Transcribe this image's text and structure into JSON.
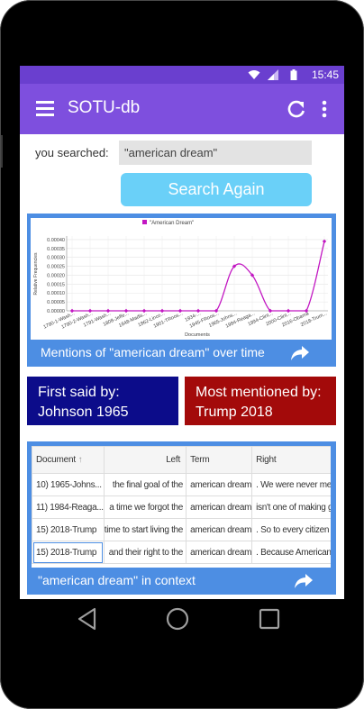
{
  "status_bar": {
    "time": "15:45"
  },
  "app_bar": {
    "title": "SOTU-db"
  },
  "search": {
    "label": "you searched:",
    "value": "\"american dream\"",
    "button_label": "Search Again"
  },
  "chart_card": {
    "caption": "Mentions of \"american dream\" over time"
  },
  "first_said": {
    "line1": "First said by:",
    "line2": "Johnson 1965"
  },
  "most_mentioned": {
    "line1": "Most mentioned by:",
    "line2": "Trump 2018"
  },
  "context_table": {
    "headers": {
      "document": "Document",
      "left": "Left",
      "term": "Term",
      "right": "Right"
    },
    "rows": [
      {
        "document": "10) 1965-Johns...",
        "left": "the final goal of the",
        "term": "american dream",
        "right": ". We were never meant to"
      },
      {
        "document": "11) 1984-Reaga...",
        "left": "a time we forgot the",
        "term": "american dream",
        "right": "isn't one of making government"
      },
      {
        "document": "15) 2018-Trump",
        "left": "time to start living the",
        "term": "american dream",
        "right": ". So to every citizen watching"
      },
      {
        "document": "15) 2018-Trump",
        "left": "and their right to the",
        "term": "american dream",
        "right": ". Because Americans are dreamers too"
      }
    ],
    "caption": "\"american dream\" in context"
  },
  "colors": {
    "status_bar": "#6a3fcf",
    "app_bar": "#7e4fde",
    "search_button": "#6ad0f8",
    "card_blue": "#4d8ee3",
    "first_said": "#0c0c8a",
    "most_mentioned": "#a30a0a",
    "series": "#c217c2"
  },
  "chart_data": {
    "type": "line",
    "legend": "\"American Dream\"",
    "xlabel": "Documents",
    "ylabel": "Relative Frequencies",
    "y_ticks": [
      "0.00000",
      "0.00005",
      "0.00010",
      "0.00015",
      "0.00020",
      "0.00025",
      "0.00030",
      "0.00035",
      "0.00040"
    ],
    "ylim": [
      0,
      0.00042
    ],
    "x_ticks": [
      "1790-1-Wash...",
      "1790-2-Wash...",
      "1791-Wash...",
      "1808-Jeffe...",
      "1848-Madis...",
      "1862-Linco...",
      "1901-TRoos...",
      "1934-...",
      "1945-FRoos...",
      "1965-Johns...",
      "1984-Reaga...",
      "1994-Clint...",
      "2000-Clint...",
      "2016-Obama",
      "2018-Trum..."
    ],
    "x": [
      "1790-1-Wash...",
      "1790-2-Wash...",
      "1791-Wash...",
      "1808-Jeffe...",
      "1848-Madis...",
      "1862-Linco...",
      "1901-TRoos...",
      "1934-...",
      "1945-FRoos...",
      "1965-Johns...",
      "1984-Reaga...",
      "1994-Clint...",
      "2000-Clint...",
      "2016-Obama",
      "2018-Trum..."
    ],
    "values": [
      0,
      0,
      0,
      0,
      0,
      0,
      0,
      0,
      0,
      0.00025,
      0.0002,
      0,
      0,
      0,
      0.00039
    ],
    "grid": true,
    "legend_position": "top"
  }
}
